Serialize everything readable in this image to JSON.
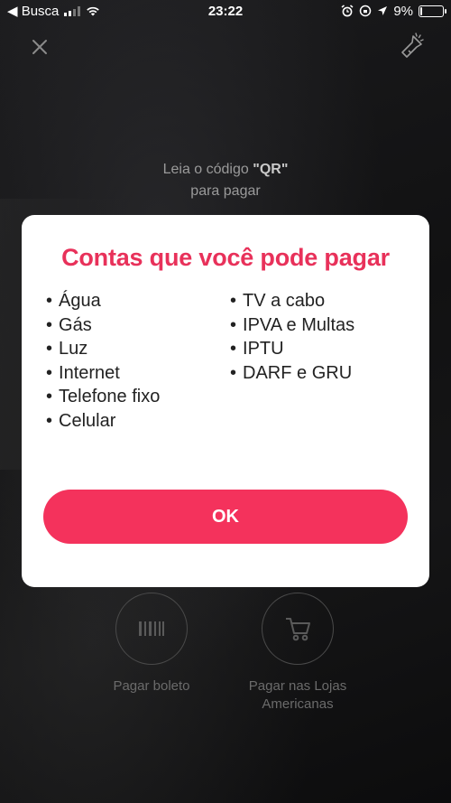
{
  "status_bar": {
    "back_label": "◀ Busca",
    "time": "23:22",
    "battery": "9%",
    "battery_level": 0.09
  },
  "scanner": {
    "instruction_line1_prefix": "Leia o código ",
    "instruction_line1_bold": "\"QR\"",
    "instruction_line2": "para pagar"
  },
  "actions": {
    "boleto_label": "Pagar boleto",
    "lojas_label": "Pagar nas Lojas Americanas"
  },
  "modal": {
    "title": "Contas que você pode pagar",
    "left_items": [
      "Água",
      "Gás",
      "Luz",
      "Internet",
      "Telefone fixo",
      "Celular"
    ],
    "right_items": [
      "TV a cabo",
      "IPVA e Multas",
      "IPTU",
      "DARF e GRU"
    ],
    "ok_label": "OK"
  },
  "colors": {
    "accent": "#f4325c",
    "title": "#e8315a"
  },
  "icons": [
    "close-icon",
    "flashlight-icon",
    "barcode-icon",
    "cart-icon",
    "wifi-icon",
    "alarm-icon",
    "location-icon"
  ]
}
